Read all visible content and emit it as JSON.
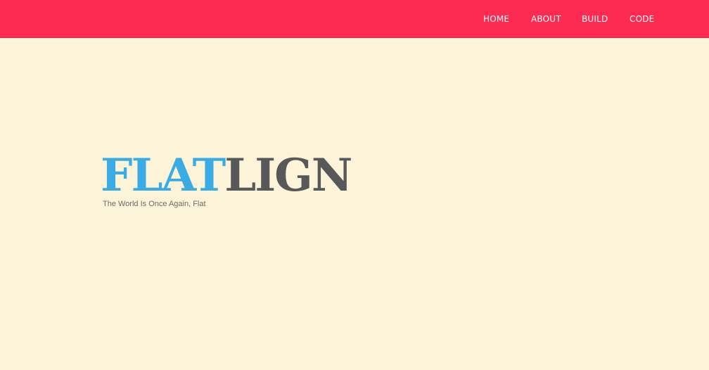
{
  "nav": {
    "items": [
      {
        "label": "HOME"
      },
      {
        "label": "ABOUT"
      },
      {
        "label": "BUILD"
      },
      {
        "label": "CODE"
      }
    ]
  },
  "hero": {
    "logo_part1": "FLAT",
    "logo_part2": "LIGN",
    "tagline": "The World Is Once Again, Flat"
  },
  "colors": {
    "header_bg": "#fd2b51",
    "page_bg": "#fcf4d9",
    "logo_blue": "#3aace3",
    "logo_grey": "#58585a"
  }
}
